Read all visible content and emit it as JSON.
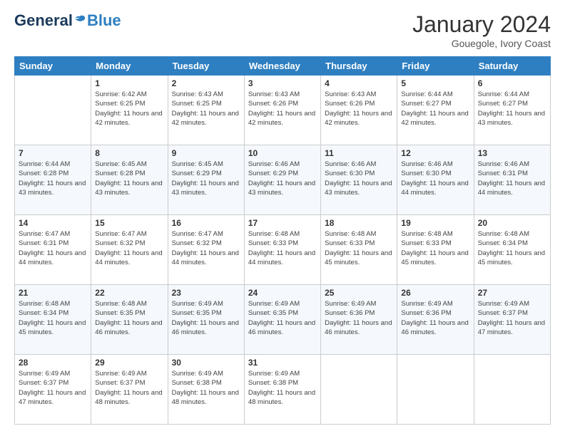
{
  "header": {
    "logo_general": "General",
    "logo_blue": "Blue",
    "month_title": "January 2024",
    "location": "Gouegole, Ivory Coast"
  },
  "days_of_week": [
    "Sunday",
    "Monday",
    "Tuesday",
    "Wednesday",
    "Thursday",
    "Friday",
    "Saturday"
  ],
  "weeks": [
    [
      {
        "day": "",
        "sunrise": "",
        "sunset": "",
        "daylight": ""
      },
      {
        "day": "1",
        "sunrise": "Sunrise: 6:42 AM",
        "sunset": "Sunset: 6:25 PM",
        "daylight": "Daylight: 11 hours and 42 minutes."
      },
      {
        "day": "2",
        "sunrise": "Sunrise: 6:43 AM",
        "sunset": "Sunset: 6:25 PM",
        "daylight": "Daylight: 11 hours and 42 minutes."
      },
      {
        "day": "3",
        "sunrise": "Sunrise: 6:43 AM",
        "sunset": "Sunset: 6:26 PM",
        "daylight": "Daylight: 11 hours and 42 minutes."
      },
      {
        "day": "4",
        "sunrise": "Sunrise: 6:43 AM",
        "sunset": "Sunset: 6:26 PM",
        "daylight": "Daylight: 11 hours and 42 minutes."
      },
      {
        "day": "5",
        "sunrise": "Sunrise: 6:44 AM",
        "sunset": "Sunset: 6:27 PM",
        "daylight": "Daylight: 11 hours and 42 minutes."
      },
      {
        "day": "6",
        "sunrise": "Sunrise: 6:44 AM",
        "sunset": "Sunset: 6:27 PM",
        "daylight": "Daylight: 11 hours and 43 minutes."
      }
    ],
    [
      {
        "day": "7",
        "sunrise": "Sunrise: 6:44 AM",
        "sunset": "Sunset: 6:28 PM",
        "daylight": "Daylight: 11 hours and 43 minutes."
      },
      {
        "day": "8",
        "sunrise": "Sunrise: 6:45 AM",
        "sunset": "Sunset: 6:28 PM",
        "daylight": "Daylight: 11 hours and 43 minutes."
      },
      {
        "day": "9",
        "sunrise": "Sunrise: 6:45 AM",
        "sunset": "Sunset: 6:29 PM",
        "daylight": "Daylight: 11 hours and 43 minutes."
      },
      {
        "day": "10",
        "sunrise": "Sunrise: 6:46 AM",
        "sunset": "Sunset: 6:29 PM",
        "daylight": "Daylight: 11 hours and 43 minutes."
      },
      {
        "day": "11",
        "sunrise": "Sunrise: 6:46 AM",
        "sunset": "Sunset: 6:30 PM",
        "daylight": "Daylight: 11 hours and 43 minutes."
      },
      {
        "day": "12",
        "sunrise": "Sunrise: 6:46 AM",
        "sunset": "Sunset: 6:30 PM",
        "daylight": "Daylight: 11 hours and 44 minutes."
      },
      {
        "day": "13",
        "sunrise": "Sunrise: 6:46 AM",
        "sunset": "Sunset: 6:31 PM",
        "daylight": "Daylight: 11 hours and 44 minutes."
      }
    ],
    [
      {
        "day": "14",
        "sunrise": "Sunrise: 6:47 AM",
        "sunset": "Sunset: 6:31 PM",
        "daylight": "Daylight: 11 hours and 44 minutes."
      },
      {
        "day": "15",
        "sunrise": "Sunrise: 6:47 AM",
        "sunset": "Sunset: 6:32 PM",
        "daylight": "Daylight: 11 hours and 44 minutes."
      },
      {
        "day": "16",
        "sunrise": "Sunrise: 6:47 AM",
        "sunset": "Sunset: 6:32 PM",
        "daylight": "Daylight: 11 hours and 44 minutes."
      },
      {
        "day": "17",
        "sunrise": "Sunrise: 6:48 AM",
        "sunset": "Sunset: 6:33 PM",
        "daylight": "Daylight: 11 hours and 44 minutes."
      },
      {
        "day": "18",
        "sunrise": "Sunrise: 6:48 AM",
        "sunset": "Sunset: 6:33 PM",
        "daylight": "Daylight: 11 hours and 45 minutes."
      },
      {
        "day": "19",
        "sunrise": "Sunrise: 6:48 AM",
        "sunset": "Sunset: 6:33 PM",
        "daylight": "Daylight: 11 hours and 45 minutes."
      },
      {
        "day": "20",
        "sunrise": "Sunrise: 6:48 AM",
        "sunset": "Sunset: 6:34 PM",
        "daylight": "Daylight: 11 hours and 45 minutes."
      }
    ],
    [
      {
        "day": "21",
        "sunrise": "Sunrise: 6:48 AM",
        "sunset": "Sunset: 6:34 PM",
        "daylight": "Daylight: 11 hours and 45 minutes."
      },
      {
        "day": "22",
        "sunrise": "Sunrise: 6:48 AM",
        "sunset": "Sunset: 6:35 PM",
        "daylight": "Daylight: 11 hours and 46 minutes."
      },
      {
        "day": "23",
        "sunrise": "Sunrise: 6:49 AM",
        "sunset": "Sunset: 6:35 PM",
        "daylight": "Daylight: 11 hours and 46 minutes."
      },
      {
        "day": "24",
        "sunrise": "Sunrise: 6:49 AM",
        "sunset": "Sunset: 6:35 PM",
        "daylight": "Daylight: 11 hours and 46 minutes."
      },
      {
        "day": "25",
        "sunrise": "Sunrise: 6:49 AM",
        "sunset": "Sunset: 6:36 PM",
        "daylight": "Daylight: 11 hours and 46 minutes."
      },
      {
        "day": "26",
        "sunrise": "Sunrise: 6:49 AM",
        "sunset": "Sunset: 6:36 PM",
        "daylight": "Daylight: 11 hours and 46 minutes."
      },
      {
        "day": "27",
        "sunrise": "Sunrise: 6:49 AM",
        "sunset": "Sunset: 6:37 PM",
        "daylight": "Daylight: 11 hours and 47 minutes."
      }
    ],
    [
      {
        "day": "28",
        "sunrise": "Sunrise: 6:49 AM",
        "sunset": "Sunset: 6:37 PM",
        "daylight": "Daylight: 11 hours and 47 minutes."
      },
      {
        "day": "29",
        "sunrise": "Sunrise: 6:49 AM",
        "sunset": "Sunset: 6:37 PM",
        "daylight": "Daylight: 11 hours and 48 minutes."
      },
      {
        "day": "30",
        "sunrise": "Sunrise: 6:49 AM",
        "sunset": "Sunset: 6:38 PM",
        "daylight": "Daylight: 11 hours and 48 minutes."
      },
      {
        "day": "31",
        "sunrise": "Sunrise: 6:49 AM",
        "sunset": "Sunset: 6:38 PM",
        "daylight": "Daylight: 11 hours and 48 minutes."
      },
      {
        "day": "",
        "sunrise": "",
        "sunset": "",
        "daylight": ""
      },
      {
        "day": "",
        "sunrise": "",
        "sunset": "",
        "daylight": ""
      },
      {
        "day": "",
        "sunrise": "",
        "sunset": "",
        "daylight": ""
      }
    ]
  ]
}
